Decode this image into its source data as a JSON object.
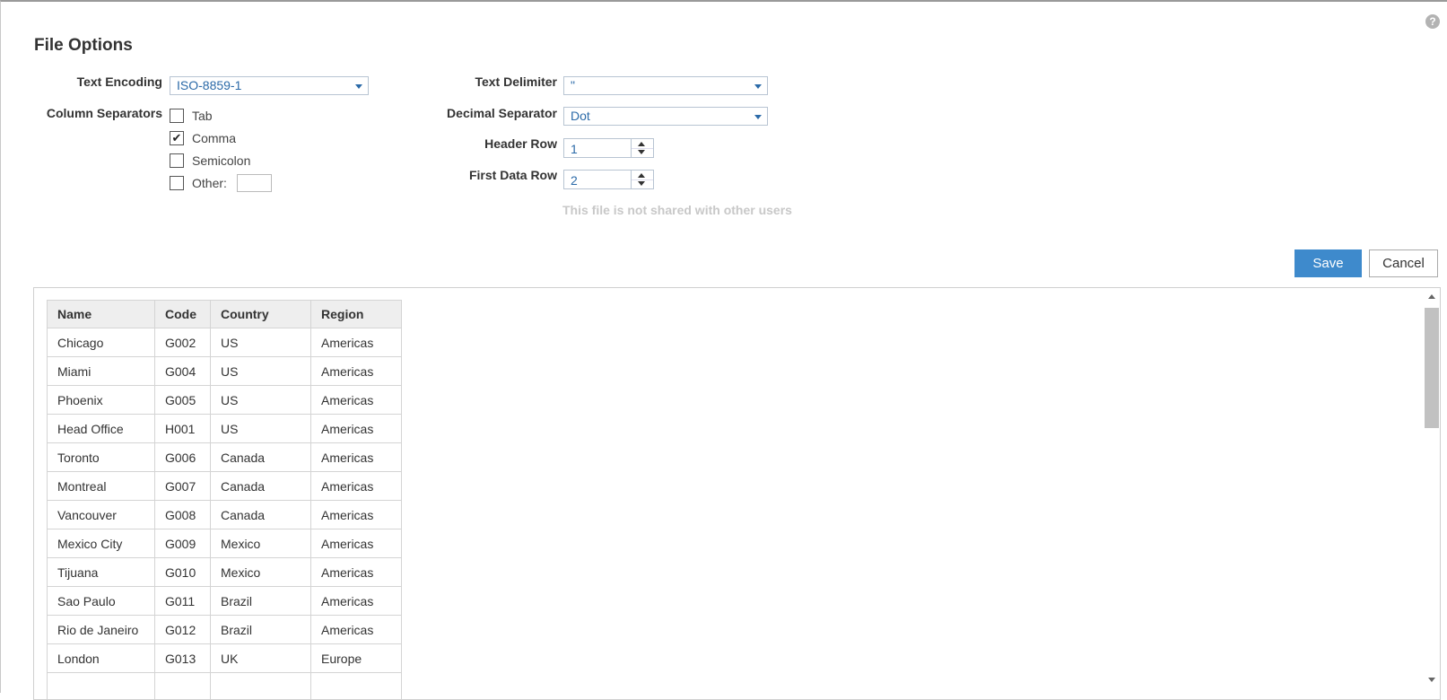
{
  "dialog": {
    "title": "File Options",
    "help_icon": "question-circle-icon"
  },
  "form": {
    "text_encoding": {
      "label": "Text Encoding",
      "value": "ISO-8859-1"
    },
    "column_separators": {
      "label": "Column Separators",
      "options": [
        {
          "label": "Tab",
          "checked": false
        },
        {
          "label": "Comma",
          "checked": true
        },
        {
          "label": "Semicolon",
          "checked": false
        },
        {
          "label": "Other:",
          "checked": false,
          "value": ""
        }
      ]
    },
    "text_delimiter": {
      "label": "Text Delimiter",
      "value": "\""
    },
    "decimal_separator": {
      "label": "Decimal Separator",
      "value": "Dot"
    },
    "header_row": {
      "label": "Header Row",
      "value": "1"
    },
    "first_data_row": {
      "label": "First Data Row",
      "value": "2"
    },
    "share_note": "This file is not shared with other users"
  },
  "buttons": {
    "save": "Save",
    "cancel": "Cancel"
  },
  "colors": {
    "accent": "#3e8acc",
    "value_text": "#2b6aa8"
  },
  "preview": {
    "columns": [
      "Name",
      "Code",
      "Country",
      "Region"
    ],
    "rows": [
      [
        "Chicago",
        "G002",
        "US",
        "Americas"
      ],
      [
        "Miami",
        "G004",
        "US",
        "Americas"
      ],
      [
        "Phoenix",
        "G005",
        "US",
        "Americas"
      ],
      [
        "Head Office",
        "H001",
        "US",
        "Americas"
      ],
      [
        "Toronto",
        "G006",
        "Canada",
        "Americas"
      ],
      [
        "Montreal",
        "G007",
        "Canada",
        "Americas"
      ],
      [
        "Vancouver",
        "G008",
        "Canada",
        "Americas"
      ],
      [
        "Mexico City",
        "G009",
        "Mexico",
        "Americas"
      ],
      [
        "Tijuana",
        "G010",
        "Mexico",
        "Americas"
      ],
      [
        "Sao Paulo",
        "G011",
        "Brazil",
        "Americas"
      ],
      [
        "Rio de Janeiro",
        "G012",
        "Brazil",
        "Americas"
      ],
      [
        "London",
        "G013",
        "UK",
        "Europe"
      ],
      [
        "",
        "",
        "",
        ""
      ]
    ]
  }
}
